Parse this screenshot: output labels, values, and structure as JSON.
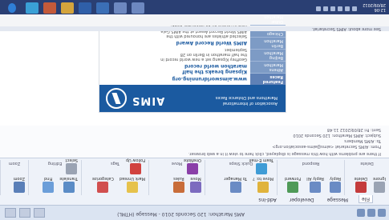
{
  "window": {
    "title": "AMS Marathon: 120 Seconds 2010 - Message (HTML)"
  },
  "ribbon": {
    "tabs": [
      "File",
      "Message",
      "Developer",
      "Add-Ins"
    ],
    "groups": [
      {
        "label": "Delete",
        "buttons": [
          "Ignore",
          "Delete"
        ]
      },
      {
        "label": "Respond",
        "buttons": [
          "Reply",
          "Reply All",
          "Forward"
        ]
      },
      {
        "label": "Quick Steps",
        "buttons": [
          "Move to: ?",
          "To Manager",
          "Team E-mail"
        ]
      },
      {
        "label": "Move",
        "buttons": [
          "Move",
          "Rules",
          "OneNote"
        ]
      },
      {
        "label": "Tags",
        "buttons": [
          "Mark Unread",
          "Categorize",
          "Follow Up"
        ]
      },
      {
        "label": "Editing",
        "buttons": [
          "Translate",
          "Find",
          "Select"
        ]
      },
      {
        "label": "Zoom",
        "buttons": [
          "Zoom"
        ]
      }
    ]
  },
  "message": {
    "info_line": "If there are problems with how this message is displayed, click here to view it in a web browser.",
    "from_label": "From:",
    "from_value": "AIMS Secretariat <aims@aims-association.org>",
    "to_label": "To:",
    "to_value": "AIMS Members",
    "subject_label": "Subject:",
    "subject_value": "AIMS Marathon: 120 Seconds 2010",
    "sent_label": "Sent:",
    "sent_value": "Fri 28/09/2012 11:48"
  },
  "newsletter": {
    "brand": "AIMS",
    "brand_sub": "Association of International Marathons and Distance Races",
    "url": "www.aimsworldrunning.org",
    "heading1": "Kipsang breaks the half marathon world record",
    "text1": "Geoffrey Kipsang set a new world record in the half marathon in Berlin on 28 September.",
    "heading2": "AIMS World Record Award",
    "text2": "Selected athletes are honoured with the AIMS World Record Award at the AIMS Gala held in Athens on 10 November 2012.",
    "sidebar_title": "Featured Races",
    "sidebar_items": [
      "Athens Marathon",
      "Beijing Marathon",
      "Berlin Marathon",
      "Chicago Marathon",
      "Dubai Marathon"
    ]
  },
  "status": {
    "text": "See more about: AIMS Secretariat."
  },
  "taskbar": {
    "time": "12:06",
    "date": "28/09/2012"
  }
}
